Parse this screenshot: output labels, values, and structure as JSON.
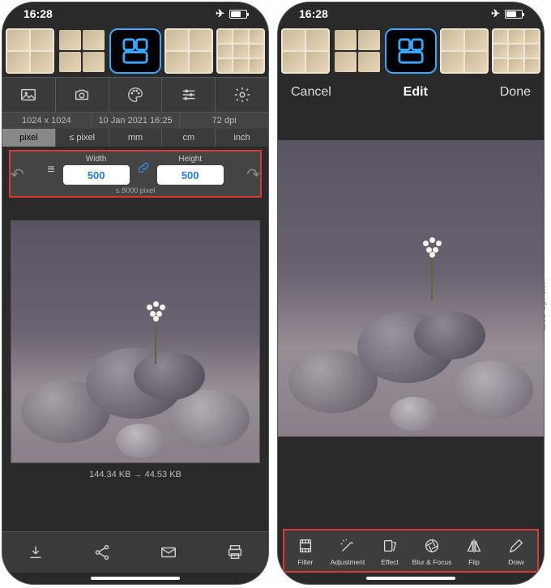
{
  "status": {
    "time": "16:28"
  },
  "left": {
    "info": {
      "dimensions": "1024 x 1024",
      "date": "10 Jan 2021 16:25",
      "dpi": "72 dpi"
    },
    "units": {
      "u0": "pixel",
      "u1": "≤ pixel",
      "u2": "mm",
      "u3": "cm",
      "u4": "inch"
    },
    "size": {
      "width_label": "Width",
      "width_value": "500",
      "height_label": "Height",
      "height_value": "500",
      "hint": "≤ 8000 pixel"
    },
    "stats": {
      "before": "144.34 KB",
      "arrow": "→",
      "after": "44.53 KB"
    }
  },
  "right": {
    "header": {
      "cancel": "Cancel",
      "title": "Edit",
      "done": "Done"
    },
    "tools": {
      "t0": "Filter",
      "t1": "Adjustment",
      "t2": "Effect",
      "t3": "Blur & Focus",
      "t4": "Flip",
      "t5": "Draw"
    }
  },
  "watermark": "wsxdn.com"
}
